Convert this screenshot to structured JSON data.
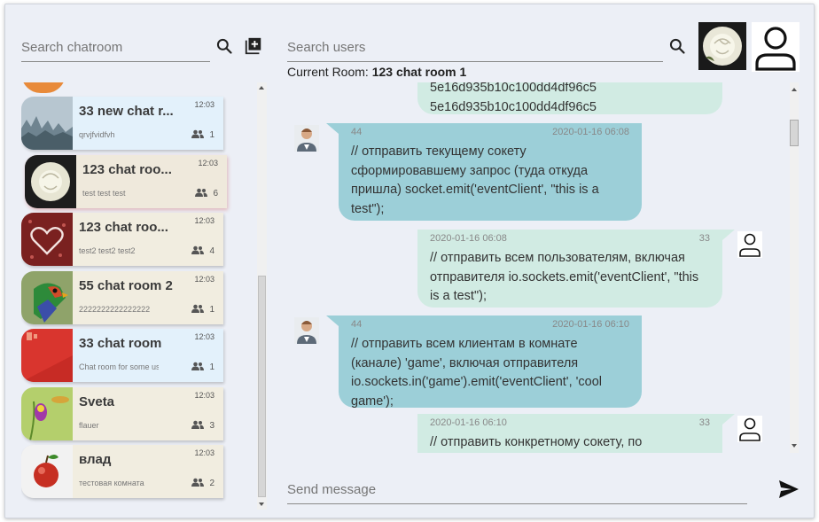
{
  "rooms_search": {
    "placeholder": "Search chatroom"
  },
  "users_search": {
    "placeholder": "Search users"
  },
  "current_room": {
    "label": "Current Room:",
    "name": "123 chat room 1"
  },
  "rooms": [
    {
      "name": "33 new chat r...",
      "sub": "qrvjfvidfvh",
      "time": "12:03",
      "count": "1",
      "theme": "blue",
      "thumb": "fog-forest"
    },
    {
      "name": "123 chat roo...",
      "sub": "test test test",
      "time": "12:03",
      "count": "6",
      "theme": "beige",
      "thumb": "white-rose",
      "active": true
    },
    {
      "name": "123 chat roo...",
      "sub": "test2 test2 test2",
      "time": "12:03",
      "count": "4",
      "theme": "beige",
      "thumb": "heart"
    },
    {
      "name": "55 chat room 2",
      "sub": "2222222222222222",
      "time": "12:03",
      "count": "1",
      "theme": "beige",
      "thumb": "parrot"
    },
    {
      "name": "33 chat room",
      "sub": "Chat room for some us...",
      "time": "12:03",
      "count": "1",
      "theme": "blue",
      "thumb": "red-pattern"
    },
    {
      "name": "Sveta",
      "sub": "flauer",
      "time": "12:03",
      "count": "3",
      "theme": "beige",
      "thumb": "flower"
    },
    {
      "name": "влад",
      "sub": "тестовая комната",
      "time": "12:03",
      "count": "2",
      "theme": "beige",
      "thumb": "apple"
    }
  ],
  "messages": [
    {
      "dir": "out",
      "lines": [
        "5e16d935b10c100dd4df96c5",
        "5e16d935b10c100dd4df96c5"
      ]
    },
    {
      "dir": "in",
      "user": "44",
      "date": "2020-01-16 06:08",
      "text": "// отправить текущему сокету сформировавшему запрос (туда откуда пришла) socket.emit('eventClient', \"this is a test\");"
    },
    {
      "dir": "out",
      "user": "33",
      "date": "2020-01-16 06:08",
      "text": "// отправить всем пользователям, включая отправителя io.sockets.emit('eventClient', \"this is a test\");"
    },
    {
      "dir": "in",
      "user": "44",
      "date": "2020-01-16 06:10",
      "text": "// отправить всем клиентам в комнате (канале) 'game', включая отправителя io.sockets.in('game').emit('eventClient', 'cool game');"
    },
    {
      "dir": "out",
      "user": "33",
      "date": "2020-01-16 06:10",
      "text": "// отправить конкретному сокету, по"
    }
  ],
  "composer": {
    "placeholder": "Send message"
  }
}
